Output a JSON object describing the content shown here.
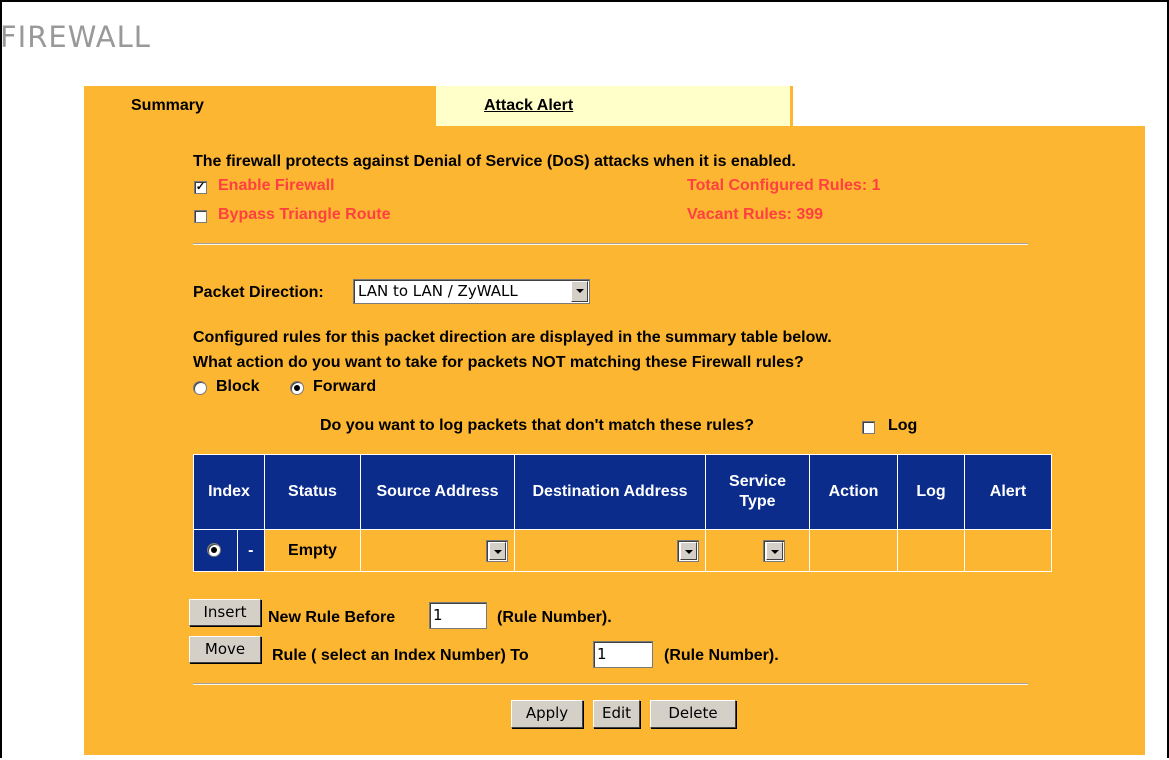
{
  "page": {
    "title": "FIREWALL"
  },
  "tabs": {
    "summary": "Summary",
    "attack_alert": "Attack Alert"
  },
  "intro": "The firewall protects against Denial of Service (DoS) attacks when it is enabled.",
  "options": {
    "enable_firewall": {
      "label": "Enable Firewall",
      "checked": true
    },
    "bypass_triangle": {
      "label": "Bypass Triangle Route",
      "checked": false
    }
  },
  "stats": {
    "total": "Total Configured Rules: 1",
    "vacant": "Vacant Rules: 399"
  },
  "packet_direction": {
    "label": "Packet Direction:",
    "value": "LAN to LAN / ZyWALL"
  },
  "text": {
    "configured_note": "Configured rules for this packet direction are displayed in the summary table below.",
    "action_question": "What action do you want to take for packets NOT matching these Firewall rules?",
    "log_question": "Do you want to log packets that don't match these rules?"
  },
  "default_action": {
    "block": "Block",
    "forward": "Forward",
    "selected": "Forward"
  },
  "log_option": {
    "label": "Log",
    "checked": false
  },
  "table": {
    "headers": {
      "index": "Index",
      "status": "Status",
      "source": "Source Address",
      "destination": "Destination Address",
      "service_line1": "Service",
      "service_line2": "Type",
      "action": "Action",
      "log": "Log",
      "alert": "Alert"
    },
    "row": {
      "index_dash": "-",
      "status": "Empty"
    }
  },
  "insert_row": {
    "button": "Insert",
    "label": "New Rule Before",
    "value": "1",
    "suffix": "(Rule Number)."
  },
  "move_row": {
    "button": "Move",
    "label": "Rule ( select an Index Number) To",
    "value": "1",
    "suffix": "(Rule Number)."
  },
  "buttons": {
    "apply": "Apply",
    "edit": "Edit",
    "delete": "Delete"
  },
  "colors": {
    "panel": "#fcb632",
    "tab_inactive": "#ffffc9",
    "table_header": "#0c2c8c",
    "alert_text": "#ff4040"
  }
}
